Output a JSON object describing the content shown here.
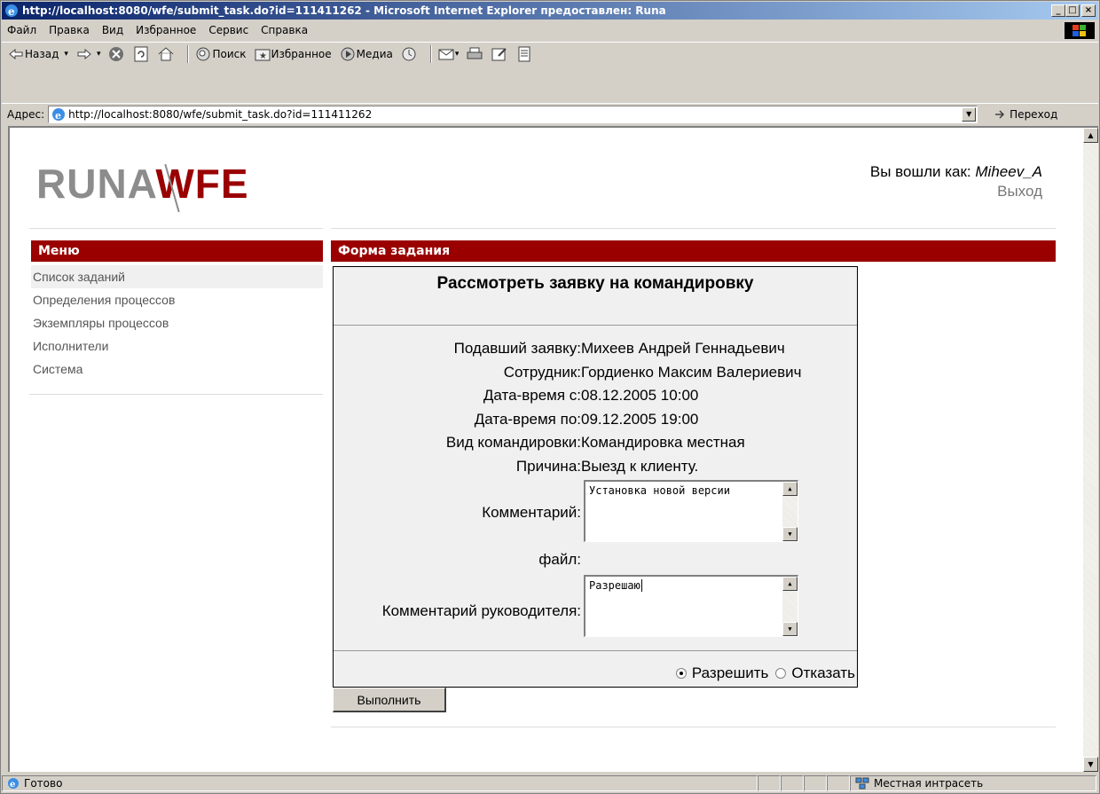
{
  "window": {
    "title": "http://localhost:8080/wfe/submit_task.do?id=111411262 - Microsoft Internet Explorer предоставлен: Runa",
    "minimize": "_",
    "maximize": "□",
    "close": "×"
  },
  "menubar": [
    "Файл",
    "Правка",
    "Вид",
    "Избранное",
    "Сервис",
    "Справка"
  ],
  "toolbar": {
    "back": "Назад",
    "search": "Поиск",
    "favorites": "Избранное",
    "media": "Медиа"
  },
  "address": {
    "label": "Адрес:",
    "url": "http://localhost:8080/wfe/submit_task.do?id=111411262",
    "go": "Переход"
  },
  "page": {
    "logo_left": "RUNA",
    "logo_right": "WFE",
    "logged_in_label": "Вы вошли как:",
    "username": "Miheev_A",
    "logout": "Выход",
    "menu_header": "Меню",
    "menu_items": [
      "Список заданий",
      "Определения процессов",
      "Экземпляры процессов",
      "Исполнители",
      "Система"
    ],
    "form_header": "Форма задания",
    "form_title": "Рассмотреть заявку на командировку",
    "fields": [
      {
        "label": "Подавший заявку:",
        "value": "Михеев Андрей Геннадьевич"
      },
      {
        "label": "Сотрудник:",
        "value": "Гордиенко Максим Валериевич"
      },
      {
        "label": "Дата-время с:",
        "value": "08.12.2005 10:00"
      },
      {
        "label": "Дата-время по:",
        "value": "09.12.2005 19:00"
      },
      {
        "label": "Вид командировки:",
        "value": "Командировка местная"
      },
      {
        "label": "Причина:",
        "value": "Выезд к клиенту."
      }
    ],
    "comment_label": "Комментарий:",
    "comment_value": "Установка новой версии",
    "file_label": "файл:",
    "manager_comment_label": "Комментарий руководителя:",
    "manager_comment_value": "Разрешаю",
    "approve": "Разрешить",
    "reject": "Отказать",
    "submit": "Выполнить"
  },
  "status": {
    "text": "Готово",
    "zone": "Местная интрасеть"
  }
}
